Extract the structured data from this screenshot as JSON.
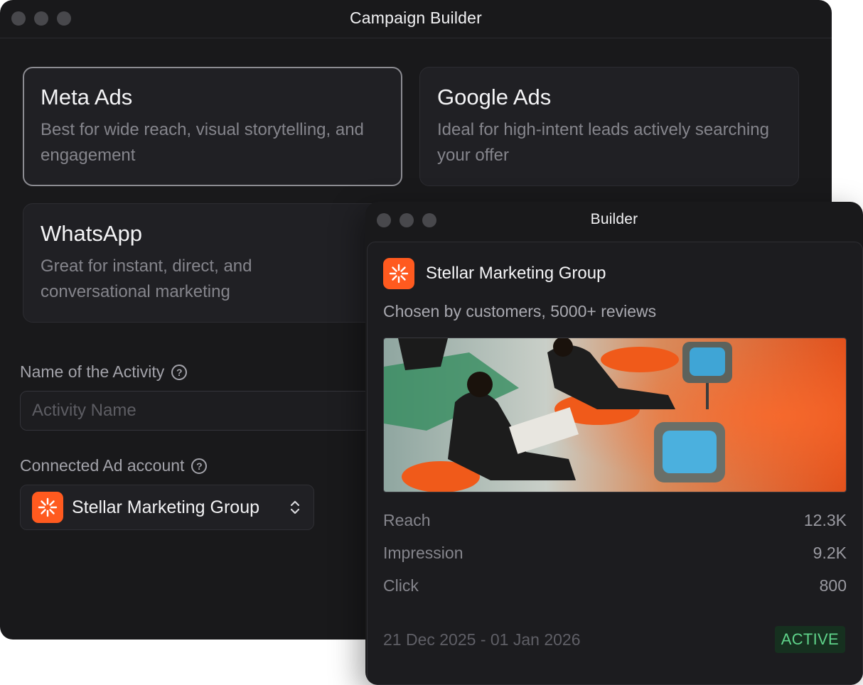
{
  "window1": {
    "title": "Campaign Builder",
    "channels": [
      {
        "title": "Meta Ads",
        "desc": "Best for wide reach, visual storytelling, and engagement",
        "selected": true
      },
      {
        "title": "Google Ads",
        "desc": "Ideal for high-intent leads actively searching your offer",
        "selected": false
      },
      {
        "title": "WhatsApp",
        "desc": "Great for instant, direct, and conversational marketing",
        "selected": false
      }
    ],
    "activity": {
      "label": "Name of the Activity",
      "placeholder": "Activity Name",
      "value": ""
    },
    "ad_account": {
      "label": "Connected Ad account",
      "selected": "Stellar Marketing Group"
    }
  },
  "window2": {
    "title": "Builder",
    "account_name": "Stellar Marketing Group",
    "tagline": "Chosen by customers, 5000+ reviews",
    "stats": [
      {
        "label": "Reach",
        "value": "12.3K"
      },
      {
        "label": "Impression",
        "value": "9.2K"
      },
      {
        "label": "Click",
        "value": "800"
      }
    ],
    "date_range": "21 Dec 2025 - 01 Jan 2026",
    "status": "ACTIVE"
  },
  "colors": {
    "brand": "#ff5a1f",
    "status_active": "#5fd38a",
    "window_bg": "#19191b"
  },
  "icons": {
    "help": "help-circle-icon",
    "chevron": "chevron-up-down-icon",
    "logo": "sunburst-logo-icon"
  }
}
